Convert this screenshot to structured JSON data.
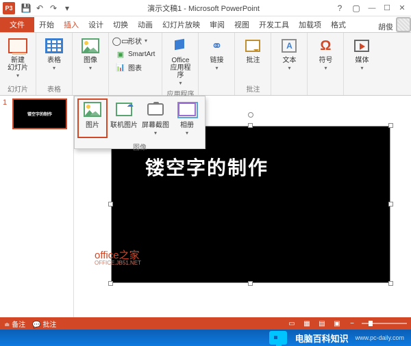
{
  "titlebar": {
    "app_icon": "P3",
    "title": "演示文稿1 - Microsoft PowerPoint"
  },
  "tabs": {
    "file": "文件",
    "items": [
      "开始",
      "插入",
      "设计",
      "切换",
      "动画",
      "幻灯片放映",
      "审阅",
      "视图",
      "开发工具",
      "加载项",
      "格式"
    ],
    "active_index": 1,
    "user": "胡俊"
  },
  "ribbon": {
    "groups": {
      "slides": {
        "new_slide": "新建\n幻灯片",
        "label": "幻灯片"
      },
      "tables": {
        "table": "表格",
        "label": "表格"
      },
      "images": {
        "image": "图像",
        "label": ""
      },
      "illustrations": {
        "shapes": "形状",
        "smartart": "SmartArt",
        "chart": "图表"
      },
      "apps": {
        "office": "Office\n应用程序",
        "label": "应用程序"
      },
      "links": {
        "link": "链接"
      },
      "comments": {
        "comment": "批注",
        "label": "批注"
      },
      "text": {
        "text": "文本"
      },
      "symbols": {
        "symbol": "符号"
      },
      "media": {
        "media": "媒体"
      }
    }
  },
  "dropdown": {
    "items": [
      {
        "label": "图片",
        "hl": true
      },
      {
        "label": "联机图片",
        "hl": false
      },
      {
        "label": "屏幕截图",
        "hl": false
      },
      {
        "label": "相册",
        "hl": false
      }
    ],
    "group_label": "图像"
  },
  "slide_panel": {
    "num": "1",
    "thumb_text": "镂空字的制作"
  },
  "canvas": {
    "text": "镂空字的制作",
    "watermark1": "office之家",
    "watermark2": "OFFICE.JB51.NET"
  },
  "statusbar": {
    "notes": "备注",
    "comments": "批注"
  },
  "banner": {
    "title": "电脑百科知识",
    "url": "www.pc-daily.com"
  }
}
